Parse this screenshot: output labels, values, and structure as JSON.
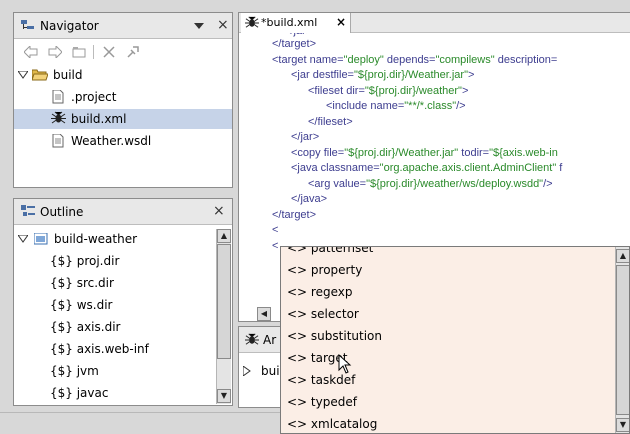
{
  "navigator": {
    "title": "Navigator",
    "tree": [
      {
        "label": "build",
        "icon": "folder-open-icon"
      },
      {
        "label": ".project",
        "icon": "file-icon"
      },
      {
        "label": "build.xml",
        "icon": "ant-icon"
      },
      {
        "label": "Weather.wsdl",
        "icon": "file-icon"
      }
    ]
  },
  "outline": {
    "title": "Outline",
    "root": "build-weather",
    "items": [
      "{$} proj.dir",
      "{$} src.dir",
      "{$} ws.dir",
      "{$} axis.dir",
      "{$} axis.web-inf",
      "{$} jvm",
      "{$} javac"
    ]
  },
  "editor": {
    "tab_label": "*build.xml",
    "lines": [
      {
        "t": "</target>"
      },
      {
        "a": "<target name=",
        "b": "\"deploy\"",
        "c": " depends=",
        "d": "\"compilews\"",
        "e": " description="
      },
      {
        "a": "<jar destfile=",
        "b": "\"${proj.dir}/Weather.jar\"",
        "c": ">"
      },
      {
        "a": "<fileset dir=",
        "b": "\"${proj.dir}/weather\"",
        "c": ">"
      },
      {
        "a": "<include name=",
        "b": "\"**/*.class\"",
        "c": "/>"
      },
      {
        "t": "</fileset>"
      },
      {
        "t": "</jar>"
      },
      {
        "a": "<copy file=",
        "b": "\"${proj.dir}/Weather.jar\"",
        "c": " todir=",
        "d": "\"${axis.web-in"
      },
      {
        "a": "<java classname=",
        "b": "\"org.apache.axis.client.AdminClient\"",
        "c": " f"
      },
      {
        "a": "<arg value=",
        "b": "\"${proj.dir}/weather/ws/deploy.wsdd\"",
        "c": "/>"
      },
      {
        "t": "</java>"
      },
      {
        "t": "</target>"
      },
      {
        "t": "<"
      },
      {
        "t": "<"
      }
    ]
  },
  "bottom_panel": {
    "tab_label": "Ar",
    "row_label": "bui"
  },
  "autocomplete": {
    "items": [
      "<> patternset",
      "<> property",
      "<> regexp",
      "<> selector",
      "<> substitution",
      "<> target",
      "<> taskdef",
      "<> typedef",
      "<> xmlcatalog"
    ]
  },
  "colors": {
    "popup_bg": "#fbeee6",
    "selected_row": "#c6d3e8",
    "xml_tag": "#3d3d8f",
    "xml_value": "#2a8a2a"
  }
}
